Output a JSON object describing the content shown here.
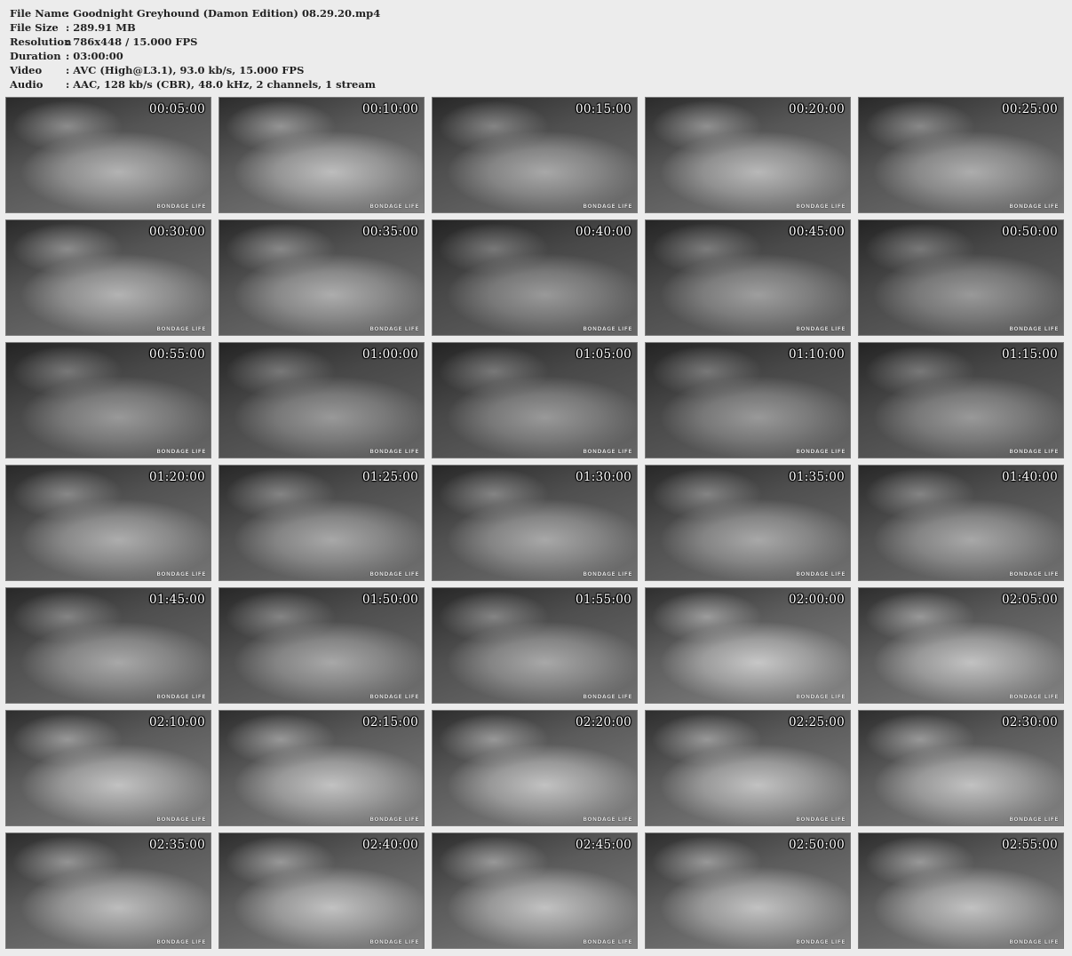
{
  "info": [
    {
      "label": "File Name",
      "value": ": Goodnight Greyhound (Damon Edition) 08.29.20.mp4"
    },
    {
      "label": "File Size",
      "value": ": 289.91 MB"
    },
    {
      "label": "Resolution",
      "value": ": 786x448 / 15.000 FPS"
    },
    {
      "label": "Duration",
      "value": ": 03:00:00"
    },
    {
      "label": "Video",
      "value": ": AVC (High@L3.1), 93.0 kb/s, 15.000 FPS"
    },
    {
      "label": "Audio",
      "value": ": AAC, 128 kb/s (CBR), 48.0 kHz, 2 channels, 1 stream"
    }
  ],
  "watermark": "BONDAGE LIFE",
  "thumbnails": [
    {
      "time": "00:05:00",
      "tone": 0.7
    },
    {
      "time": "00:10:00",
      "tone": 0.74
    },
    {
      "time": "00:15:00",
      "tone": 0.66
    },
    {
      "time": "00:20:00",
      "tone": 0.72
    },
    {
      "time": "00:25:00",
      "tone": 0.68
    },
    {
      "time": "00:30:00",
      "tone": 0.7
    },
    {
      "time": "00:35:00",
      "tone": 0.68
    },
    {
      "time": "00:40:00",
      "tone": 0.6
    },
    {
      "time": "00:45:00",
      "tone": 0.62
    },
    {
      "time": "00:50:00",
      "tone": 0.6
    },
    {
      "time": "00:55:00",
      "tone": 0.6
    },
    {
      "time": "01:00:00",
      "tone": 0.6
    },
    {
      "time": "01:05:00",
      "tone": 0.6
    },
    {
      "time": "01:10:00",
      "tone": 0.6
    },
    {
      "time": "01:15:00",
      "tone": 0.6
    },
    {
      "time": "01:20:00",
      "tone": 0.68
    },
    {
      "time": "01:25:00",
      "tone": 0.66
    },
    {
      "time": "01:30:00",
      "tone": 0.66
    },
    {
      "time": "01:35:00",
      "tone": 0.66
    },
    {
      "time": "01:40:00",
      "tone": 0.66
    },
    {
      "time": "01:45:00",
      "tone": 0.66
    },
    {
      "time": "01:50:00",
      "tone": 0.66
    },
    {
      "time": "01:55:00",
      "tone": 0.66
    },
    {
      "time": "02:00:00",
      "tone": 0.78
    },
    {
      "time": "02:05:00",
      "tone": 0.76
    },
    {
      "time": "02:10:00",
      "tone": 0.76
    },
    {
      "time": "02:15:00",
      "tone": 0.76
    },
    {
      "time": "02:20:00",
      "tone": 0.76
    },
    {
      "time": "02:25:00",
      "tone": 0.76
    },
    {
      "time": "02:30:00",
      "tone": 0.76
    },
    {
      "time": "02:35:00",
      "tone": 0.74
    },
    {
      "time": "02:40:00",
      "tone": 0.76
    },
    {
      "time": "02:45:00",
      "tone": 0.76
    },
    {
      "time": "02:50:00",
      "tone": 0.76
    },
    {
      "time": "02:55:00",
      "tone": 0.76
    }
  ]
}
